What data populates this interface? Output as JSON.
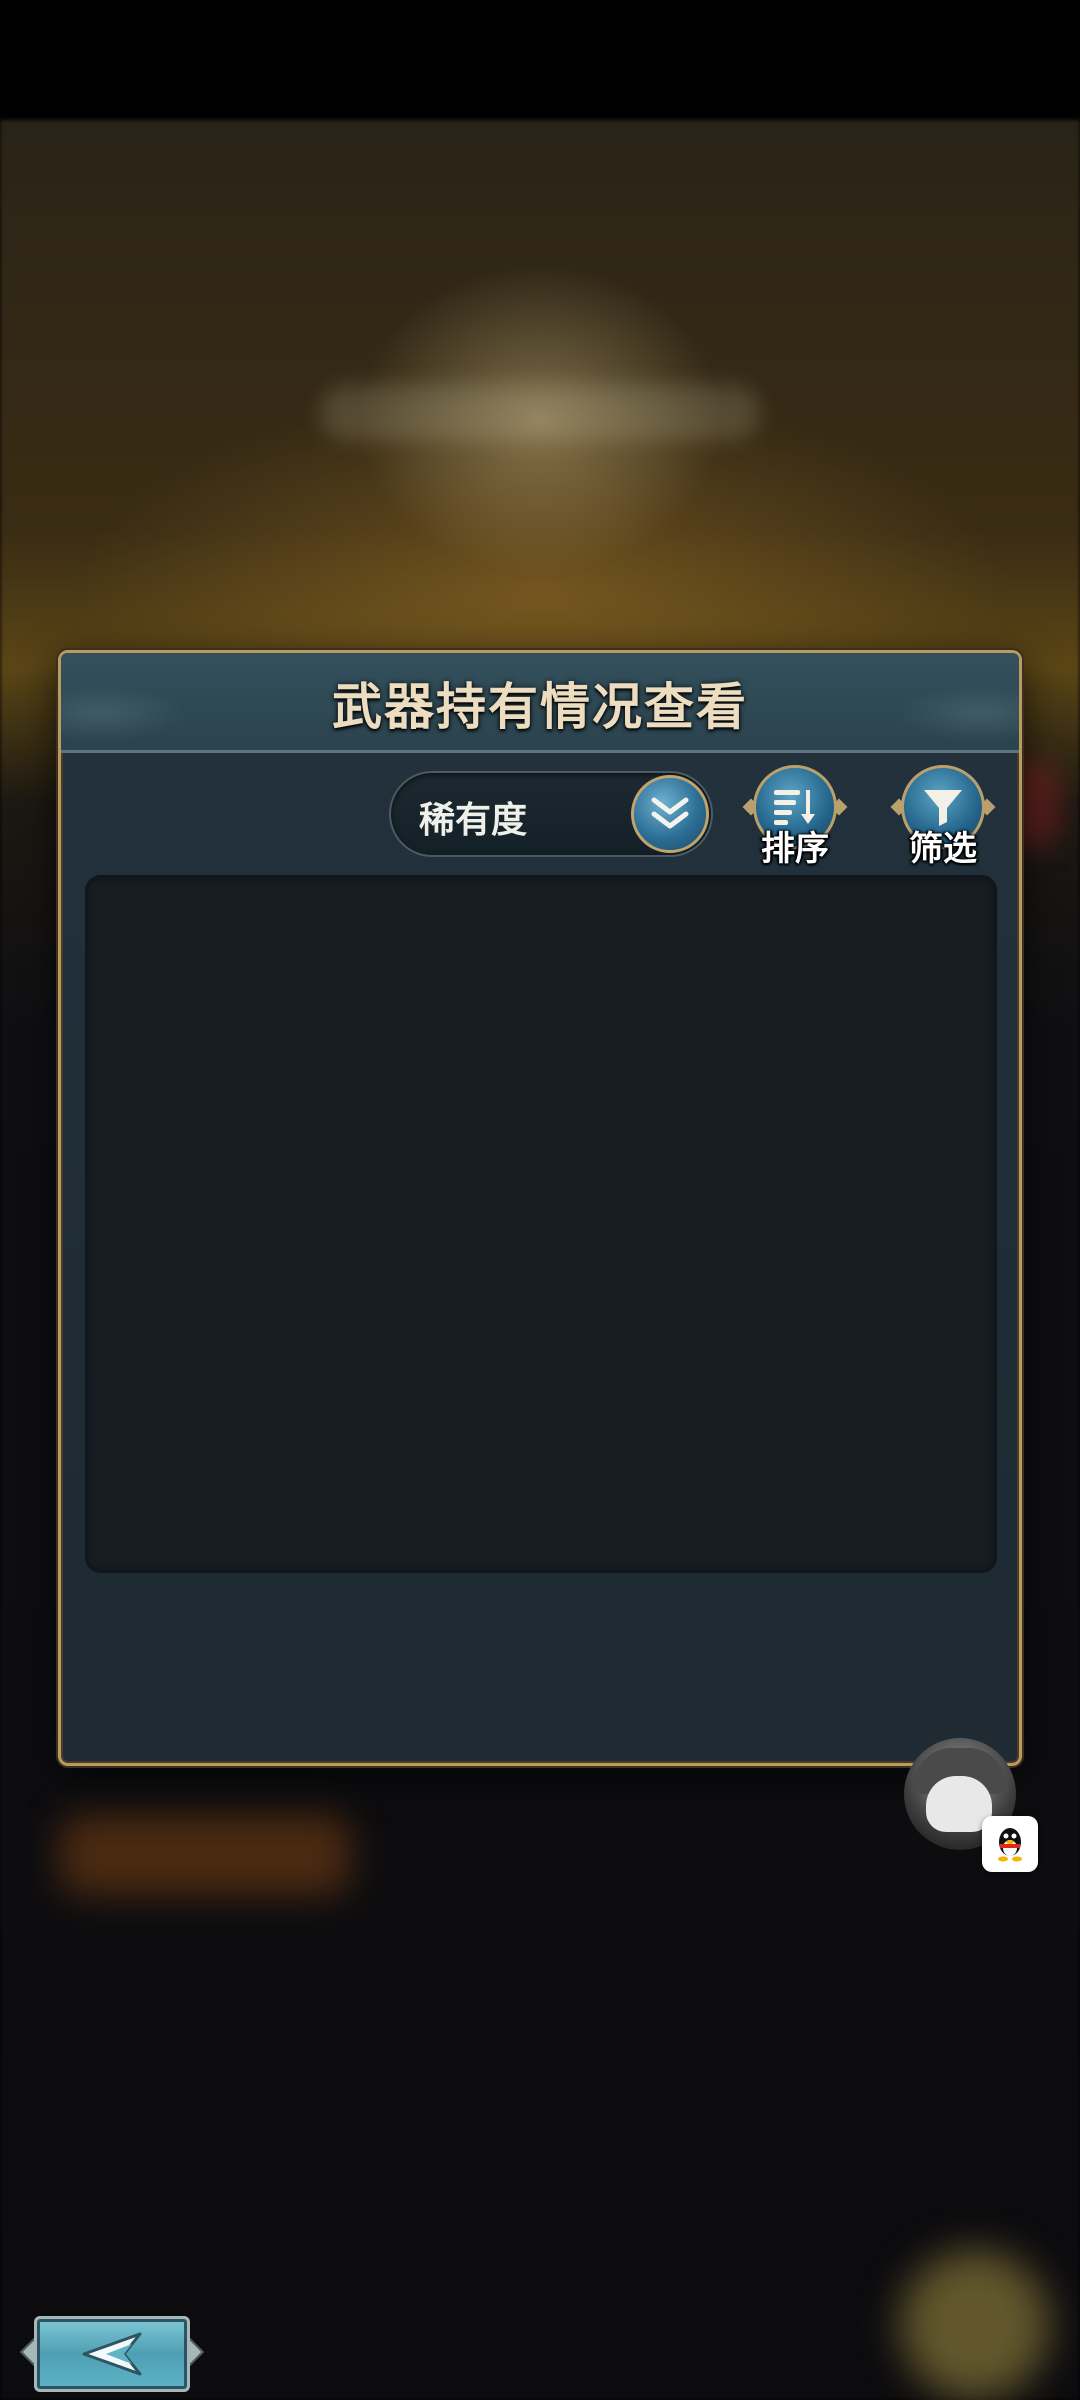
{
  "panel": {
    "title": "武器持有情况查看"
  },
  "toolbar": {
    "sort_field": "稀有度",
    "sort_label": "排序",
    "filter_label": "筛选"
  },
  "icons": {
    "dropdown": "double-chevron-down-icon",
    "sort": "sort-lines-icon",
    "filter": "funnel-icon",
    "back": "back-arrow-icon",
    "qq": "qq-penguin-icon"
  },
  "colors": {
    "panel_border": "#b99b62",
    "panel_bg": "#22323d",
    "button_blue": "#2c6f95",
    "title_text": "#ecdcc0"
  }
}
